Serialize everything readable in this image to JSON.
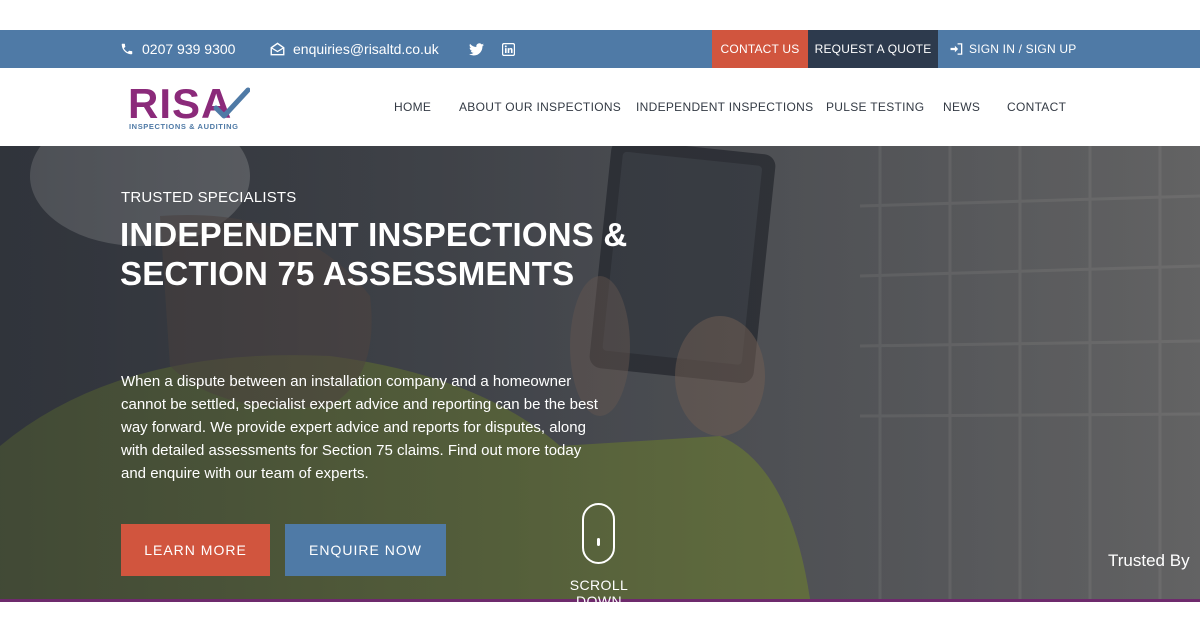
{
  "colors": {
    "topbar": "#4f7aa6",
    "accent_orange": "#d1553e",
    "dark_navy": "#2d3a4d",
    "brand_purple": "#8b2a7a",
    "brand_blue": "#4f7aa6"
  },
  "topbar": {
    "phone": "0207 939 9300",
    "email": "enquiries@risaltd.co.uk",
    "social_icons": [
      "twitter-icon",
      "linkedin-icon"
    ],
    "contact_label": "CONTACT US",
    "quote_label": "REQUEST A QUOTE",
    "signin_label": "SIGN IN / SIGN UP"
  },
  "logo": {
    "wordmark": "RISA",
    "tagline": "INSPECTIONS & AUDITING"
  },
  "nav": {
    "items": [
      "HOME",
      "ABOUT OUR INSPECTIONS",
      "INDEPENDENT INSPECTIONS",
      "PULSE TESTING",
      "NEWS",
      "CONTACT"
    ]
  },
  "hero": {
    "eyebrow": "TRUSTED SPECIALISTS",
    "headline": "INDEPENDENT INSPECTIONS & SECTION 75 ASSESSMENTS",
    "intro": "When a dispute between an installation company and a homeowner cannot be settled, specialist expert advice and reporting can be the best way forward. We provide expert advice and reports for disputes, along with detailed assessments for Section 75 claims. Find out more today and enquire with our team of experts.",
    "learn_more_label": "LEARN MORE",
    "enquire_label": "ENQUIRE NOW",
    "scroll_label": "SCROLL DOWN",
    "trusted_label": "Trusted By"
  }
}
